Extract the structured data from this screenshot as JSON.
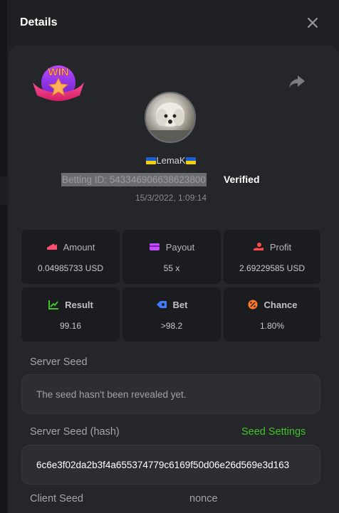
{
  "modal": {
    "title": "Details",
    "close_icon": "close-icon"
  },
  "bet": {
    "username": "LemaK",
    "flag_icon": "ukraine-flag-icon",
    "betting_id_label": "Betting ID: 543346906638623800",
    "verified_label": "Verified",
    "datetime": "15/3/2022, 1:09:14",
    "badge_text": "WIN"
  },
  "stats": [
    {
      "icon": "amount-icon",
      "label": "Amount",
      "value": "0.04985733 USD",
      "color": "#ff4f6e"
    },
    {
      "icon": "payout-icon",
      "label": "Payout",
      "value": "55 x",
      "color": "#c54bff"
    },
    {
      "icon": "profit-icon",
      "label": "Profit",
      "value": "2.69229585 USD",
      "color": "#ff4b4b"
    },
    {
      "icon": "result-icon",
      "label": "Result",
      "value": "99.16",
      "color": "#3fc326"
    },
    {
      "icon": "bet-icon",
      "label": "Bet",
      "value": ">98.2",
      "color": "#3e7bff"
    },
    {
      "icon": "chance-icon",
      "label": "Chance",
      "value": "1.80%",
      "color": "#ff7a29"
    }
  ],
  "server_seed": {
    "label": "Server Seed",
    "note": "The seed hasn't been revealed yet."
  },
  "server_seed_hash": {
    "label": "Server Seed (hash)",
    "settings_label": "Seed Settings",
    "value": "6c6e3f02da2b3f4a655374779c6169f50d06e26d569e3d163"
  },
  "client_seed": {
    "label": "Client Seed"
  },
  "nonce": {
    "label": "nonce"
  },
  "colors": {
    "accent_green": "#3fc326",
    "panel_bg": "#25262a"
  }
}
